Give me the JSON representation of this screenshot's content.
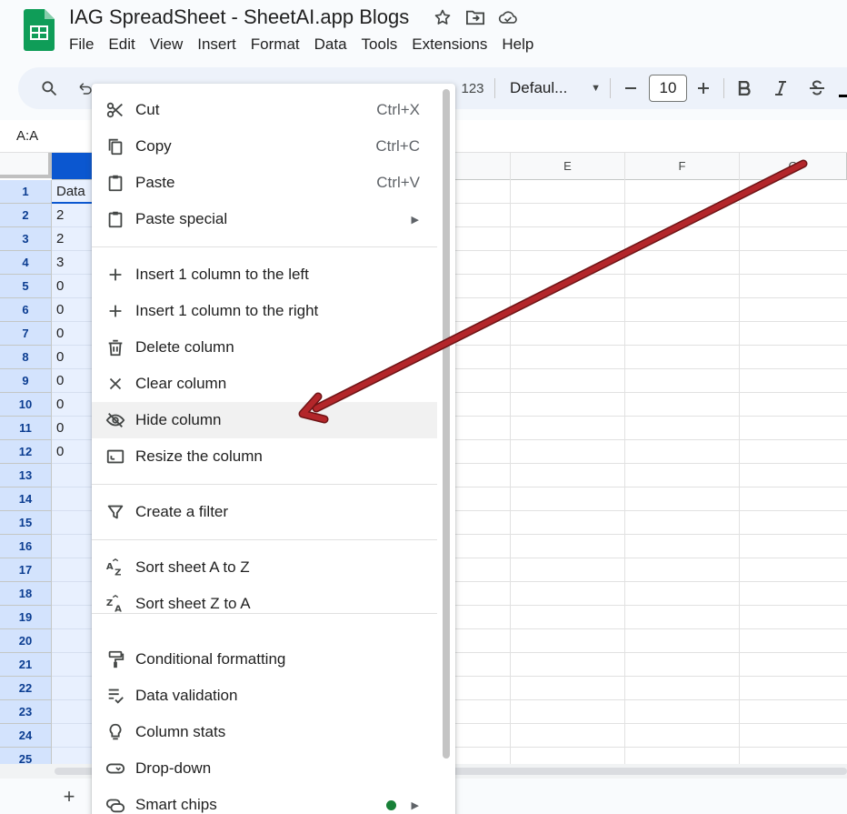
{
  "header": {
    "title": "IAG SpreadSheet - SheetAI.app Blogs",
    "menus": [
      "File",
      "Edit",
      "View",
      "Insert",
      "Format",
      "Data",
      "Tools",
      "Extensions",
      "Help"
    ]
  },
  "toolbar": {
    "number_format": "123",
    "font": "Defaul...",
    "font_size": "10"
  },
  "name_box": "A:A",
  "columns": [
    "E",
    "F",
    "G"
  ],
  "rows": [
    "1",
    "2",
    "3",
    "4",
    "5",
    "6",
    "7",
    "8",
    "9",
    "10",
    "11",
    "12",
    "13",
    "14",
    "15",
    "16",
    "17",
    "18",
    "19",
    "20",
    "21",
    "22",
    "23",
    "24",
    "25"
  ],
  "col_a_cells": [
    "Data",
    "2",
    "2",
    "3",
    "0",
    "0",
    "0",
    "0",
    "0",
    "0",
    "0",
    "0"
  ],
  "context_menu": {
    "items": [
      {
        "label": "Cut",
        "shortcut": "Ctrl+X",
        "icon": "scissors-icon"
      },
      {
        "label": "Copy",
        "shortcut": "Ctrl+C",
        "icon": "copy-icon"
      },
      {
        "label": "Paste",
        "shortcut": "Ctrl+V",
        "icon": "paste-icon"
      },
      {
        "label": "Paste special",
        "icon": "paste-special-icon"
      },
      {
        "label": "Insert 1 column to the left",
        "icon": "plus-icon"
      },
      {
        "label": "Insert 1 column to the right",
        "icon": "plus-icon"
      },
      {
        "label": "Delete column",
        "icon": "trash-icon"
      },
      {
        "label": "Clear column",
        "icon": "close-icon"
      },
      {
        "label": "Hide column",
        "icon": "eye-off-icon"
      },
      {
        "label": "Resize the column",
        "icon": "resize-icon"
      },
      {
        "label": "Create a filter",
        "icon": "filter-icon"
      },
      {
        "label": "Sort sheet A to Z",
        "icon": "sort-az-icon"
      },
      {
        "label": "Sort sheet Z to A",
        "icon": "sort-za-icon"
      },
      {
        "label": "Conditional formatting",
        "icon": "paint-roller-icon"
      },
      {
        "label": "Data validation",
        "icon": "data-validation-icon"
      },
      {
        "label": "Column stats",
        "icon": "lightbulb-icon"
      },
      {
        "label": "Drop-down",
        "icon": "dropdown-chip-icon"
      },
      {
        "label": "Smart chips",
        "icon": "smart-chips-icon"
      }
    ]
  },
  "colors": {
    "arrow": "#b3262a",
    "selected_header": "#0b57d0",
    "smart_chips_dot": "#188038"
  }
}
